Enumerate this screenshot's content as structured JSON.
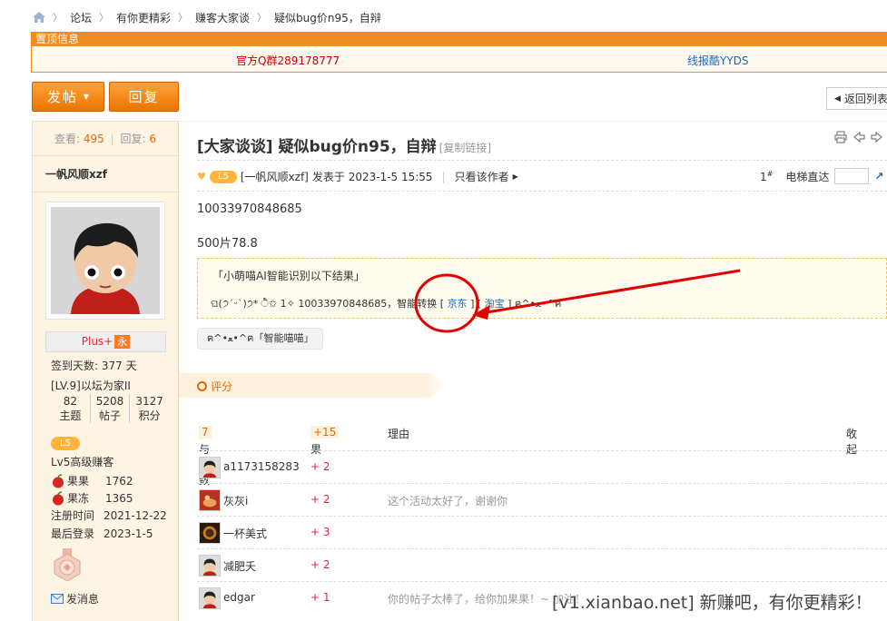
{
  "breadcrumb": [
    "论坛",
    "有你更精彩",
    "赚客大家谈",
    "疑似bug价n95，自辩"
  ],
  "sticky": {
    "header": "置顶信息",
    "link1": "官方Q群289178777",
    "link2": "线报酷YYDS"
  },
  "actions": {
    "post": "发帖",
    "reply": "回复",
    "back": "返回列表"
  },
  "sidebar": {
    "views_label": "查看:",
    "views": "495",
    "replies_label": "回复:",
    "replies": "6",
    "author": "一帆风顺xzf",
    "plus": "Plus+",
    "plus_tag": "永",
    "sign_days": "签到天数: 377 天",
    "level_title": "[LV.9]以坛为家II",
    "stats": [
      {
        "num": "82",
        "label": "主题"
      },
      {
        "num": "5208",
        "label": "帖子"
      },
      {
        "num": "3127",
        "label": "积分"
      }
    ],
    "lv_badge": "L5",
    "rank": "Lv5高级赚客",
    "fields": [
      {
        "k": "果果",
        "v": "1762",
        "apple": true
      },
      {
        "k": "果冻",
        "v": "1365",
        "apple": true
      },
      {
        "k": "注册时间",
        "v": "2021-12-22",
        "apple": false
      },
      {
        "k": "最后登录",
        "v": "2023-1-5",
        "apple": false
      }
    ],
    "message": "发消息"
  },
  "post": {
    "title": "[大家谈谈] 疑似bug价n95，自辩",
    "copy_link": "[复制链接]",
    "lv_badge": "L5",
    "meta_author": "[一帆风顺xzf]",
    "meta_time": "发表于 2023-1-5 15:55",
    "meta_sep": "|",
    "only_author": "只看该作者",
    "floor": "1",
    "floor_sup": "#",
    "elevator": "电梯直达",
    "content_line1": "10033970848685",
    "content_line2": "500片78.8",
    "ai_title": "「小萌喵AI智能识别以下结果」",
    "ai_prefix": "ଘ(੭ˊᵕˋ)੭* ੈ✩ 1✧ 10033970848685，智能转换 [ ",
    "ai_jd": "京东",
    "ai_mid": " ] [ ",
    "ai_tb": "淘宝",
    "ai_suffix": " ] ฅ^•ﻌ•^ฅ",
    "tag": "ฅ^•ﻌ•^ฅ「智能喵喵」"
  },
  "rating": {
    "label": "评分",
    "col_people": "参与人数",
    "count": "7",
    "col_score": "果果",
    "total": "+15",
    "col_reason": "理由",
    "collapse": "收起",
    "rows": [
      {
        "user": "a1173158283",
        "score": "+ 2",
        "reason": ""
      },
      {
        "user": "灰灰i",
        "score": "+ 2",
        "reason": "这个活动太好了，谢谢你"
      },
      {
        "user": "一杯美式",
        "score": "+ 3",
        "reason": ""
      },
      {
        "user": "减肥夭",
        "score": "+ 2",
        "reason": ""
      },
      {
        "user": "edgar",
        "score": "+ 1",
        "reason": "你的帖子太棒了，给你加果果！~ 加油！"
      }
    ]
  },
  "watermark": "[v1.xianbao.net] 新赚吧，有你更精彩！",
  "colors": {
    "accent": "#f28c1d",
    "link": "#2266bb",
    "annotation": "#e00000"
  }
}
